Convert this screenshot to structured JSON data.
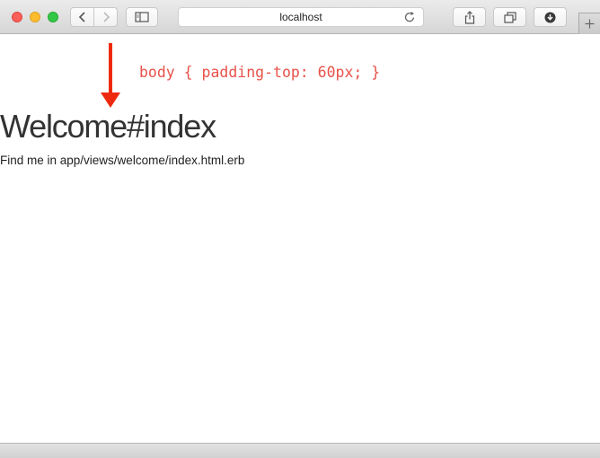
{
  "browser": {
    "address_text": "localhost",
    "icons": {
      "back": "chevron-left-icon",
      "forward": "chevron-right-icon",
      "sidebar": "sidebar-icon",
      "reload": "reload-icon",
      "share": "share-icon",
      "tabs": "tabs-overview-icon",
      "download": "download-icon",
      "new_tab": "plus-icon"
    }
  },
  "page": {
    "annotation": "body { padding-top: 60px; }",
    "heading": "Welcome#index",
    "paragraph": "Find me in app/views/welcome/index.html.erb"
  },
  "colors": {
    "annotation": "#e8524a",
    "arrow": "#ee2a0e",
    "heading": "#333333"
  }
}
